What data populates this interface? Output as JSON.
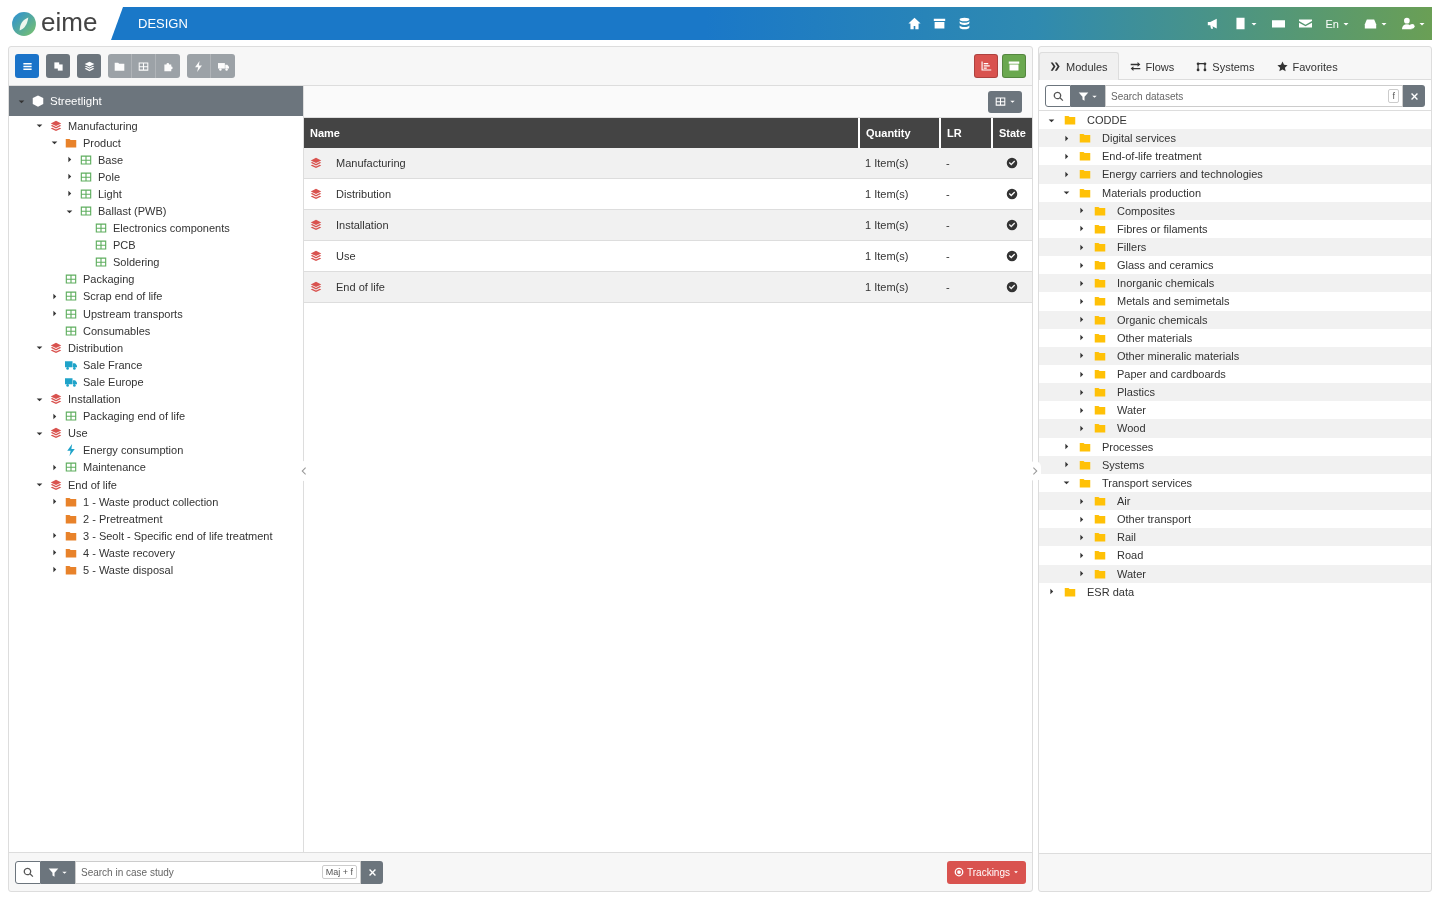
{
  "header": {
    "logo": "eime",
    "section": "DESIGN",
    "language": "En"
  },
  "toolbar": {
    "groups": [
      [
        {
          "selected": true,
          "disabled": false
        }
      ],
      [
        {
          "selected": false,
          "disabled": false
        }
      ],
      [
        {
          "selected": false,
          "disabled": false
        }
      ],
      [
        {
          "selected": false,
          "disabled": true
        },
        {
          "selected": false,
          "disabled": true
        },
        {
          "selected": false,
          "disabled": true
        }
      ],
      [
        {
          "selected": false,
          "disabled": true
        },
        {
          "selected": false,
          "disabled": true
        }
      ]
    ],
    "actions": [
      {
        "color": "#d9534f"
      },
      {
        "color": "#6aa84f"
      }
    ]
  },
  "case_tree": {
    "label": "Streetlight",
    "expanded": true,
    "children": [
      {
        "label": "Manufacturing",
        "kind": "stage",
        "expanded": true,
        "children": [
          {
            "label": "Product",
            "kind": "folder",
            "expanded": true,
            "children": [
              {
                "label": "Base",
                "kind": "dataset",
                "expanded": false
              },
              {
                "label": "Pole",
                "kind": "dataset",
                "expanded": false
              },
              {
                "label": "Light",
                "kind": "dataset",
                "expanded": false
              },
              {
                "label": "Ballast (PWB)",
                "kind": "dataset",
                "expanded": true,
                "children": [
                  {
                    "label": "Electronics components",
                    "kind": "dataset"
                  },
                  {
                    "label": "PCB",
                    "kind": "dataset"
                  },
                  {
                    "label": "Soldering",
                    "kind": "dataset"
                  }
                ]
              }
            ]
          },
          {
            "label": "Packaging",
            "kind": "dataset"
          },
          {
            "label": "Scrap end of life",
            "kind": "dataset",
            "expanded": false
          },
          {
            "label": "Upstream transports",
            "kind": "dataset",
            "expanded": false
          },
          {
            "label": "Consumables",
            "kind": "dataset"
          }
        ]
      },
      {
        "label": "Distribution",
        "kind": "stage",
        "expanded": true,
        "children": [
          {
            "label": "Sale France",
            "kind": "transport"
          },
          {
            "label": "Sale Europe",
            "kind": "transport"
          }
        ]
      },
      {
        "label": "Installation",
        "kind": "stage",
        "expanded": true,
        "children": [
          {
            "label": "Packaging end of life",
            "kind": "dataset",
            "expanded": false
          }
        ]
      },
      {
        "label": "Use",
        "kind": "stage",
        "expanded": true,
        "children": [
          {
            "label": "Energy consumption",
            "kind": "energy"
          },
          {
            "label": "Maintenance",
            "kind": "dataset",
            "expanded": false
          }
        ]
      },
      {
        "label": "End of life",
        "kind": "stage",
        "expanded": true,
        "children": [
          {
            "label": "1 - Waste product collection",
            "kind": "folder",
            "expanded": false
          },
          {
            "label": "2 - Pretreatment",
            "kind": "folder"
          },
          {
            "label": "3 - Seolt - Specific end of life treatment",
            "kind": "folder",
            "expanded": false
          },
          {
            "label": "4 - Waste recovery",
            "kind": "folder",
            "expanded": false
          },
          {
            "label": "5 - Waste disposal",
            "kind": "folder",
            "expanded": false
          }
        ]
      }
    ]
  },
  "table": {
    "columns": [
      "Name",
      "Quantity",
      "LR",
      "State"
    ],
    "rows": [
      {
        "name": "Manufacturing",
        "quantity": "1 Item(s)",
        "lr": "-",
        "valid": true
      },
      {
        "name": "Distribution",
        "quantity": "1 Item(s)",
        "lr": "-",
        "valid": true
      },
      {
        "name": "Installation",
        "quantity": "1 Item(s)",
        "lr": "-",
        "valid": true
      },
      {
        "name": "Use",
        "quantity": "1 Item(s)",
        "lr": "-",
        "valid": true
      },
      {
        "name": "End of life",
        "quantity": "1 Item(s)",
        "lr": "-",
        "valid": true
      }
    ]
  },
  "bottom_bar": {
    "search_placeholder": "Search in case study",
    "shortcut": "Maj + f",
    "trackings": "Trackings"
  },
  "library": {
    "tabs": [
      {
        "label": "Modules",
        "selected": true
      },
      {
        "label": "Flows",
        "selected": false
      },
      {
        "label": "Systems",
        "selected": false
      },
      {
        "label": "Favorites",
        "selected": false
      }
    ],
    "search_placeholder": "Search datasets",
    "shortcut": "f",
    "tree": [
      {
        "label": "CODDE",
        "expanded": true,
        "children": [
          {
            "label": "Digital services",
            "expanded": false
          },
          {
            "label": "End-of-life treatment",
            "expanded": false
          },
          {
            "label": "Energy carriers and technologies",
            "expanded": false
          },
          {
            "label": "Materials production",
            "expanded": true,
            "children": [
              {
                "label": "Composites",
                "expanded": false
              },
              {
                "label": "Fibres or filaments",
                "expanded": false
              },
              {
                "label": "Fillers",
                "expanded": false
              },
              {
                "label": "Glass and ceramics",
                "expanded": false
              },
              {
                "label": "Inorganic chemicals",
                "expanded": false
              },
              {
                "label": "Metals and semimetals",
                "expanded": false
              },
              {
                "label": "Organic chemicals",
                "expanded": false
              },
              {
                "label": "Other materials",
                "expanded": false
              },
              {
                "label": "Other mineralic materials",
                "expanded": false
              },
              {
                "label": "Paper and cardboards",
                "expanded": false
              },
              {
                "label": "Plastics",
                "expanded": false
              },
              {
                "label": "Water",
                "expanded": false
              },
              {
                "label": "Wood",
                "expanded": false
              }
            ]
          },
          {
            "label": "Processes",
            "expanded": false
          },
          {
            "label": "Systems",
            "expanded": false
          },
          {
            "label": "Transport services",
            "expanded": true,
            "children": [
              {
                "label": "Air",
                "expanded": false
              },
              {
                "label": "Other transport",
                "expanded": false
              },
              {
                "label": "Rail",
                "expanded": false
              },
              {
                "label": "Road",
                "expanded": false
              },
              {
                "label": "Water",
                "expanded": false
              }
            ]
          }
        ]
      },
      {
        "label": "ESR data",
        "expanded": false
      }
    ]
  }
}
